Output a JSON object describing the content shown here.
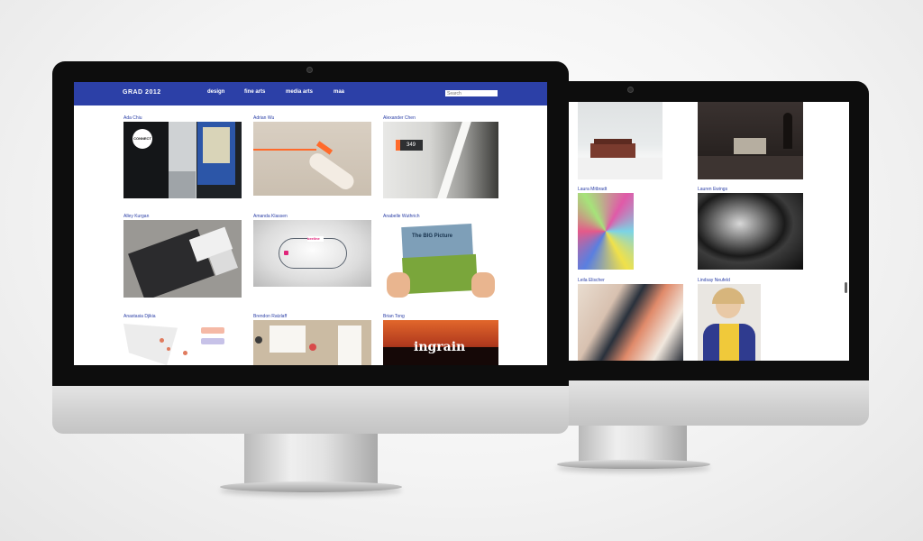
{
  "site": {
    "title": "GRAD 2012",
    "nav": [
      "design",
      "fine arts",
      "media arts",
      "maa"
    ],
    "search_placeholder": "Search"
  },
  "front_grid": [
    {
      "name": "Ada Chiu",
      "thumb_text": "CONNECT"
    },
    {
      "name": "Adrian Wu"
    },
    {
      "name": "Alexander Chen",
      "thumb_text": "349"
    },
    {
      "name": "Alley Kurgan"
    },
    {
      "name": "Amanda Klassen",
      "thumb_text": "beeline"
    },
    {
      "name": "Anabelle Wuthrich",
      "thumb_text": "The BIG Picture"
    },
    {
      "name": "Anastasia Djikia"
    },
    {
      "name": "Brendon Ratzlaff"
    },
    {
      "name": "Brian Tong",
      "thumb_text": "ingrain"
    }
  ],
  "back_grid": [
    {
      "name": ""
    },
    {
      "name": ""
    },
    {
      "name": "Laura Mitbradt"
    },
    {
      "name": "Lauren Ewings"
    },
    {
      "name": "Leila Elischer"
    },
    {
      "name": "Lindsay Neufeld"
    }
  ],
  "colors": {
    "header_blue": "#2c40a7",
    "name_blue": "#2c40a7",
    "bezel": "#0d0d0d"
  }
}
